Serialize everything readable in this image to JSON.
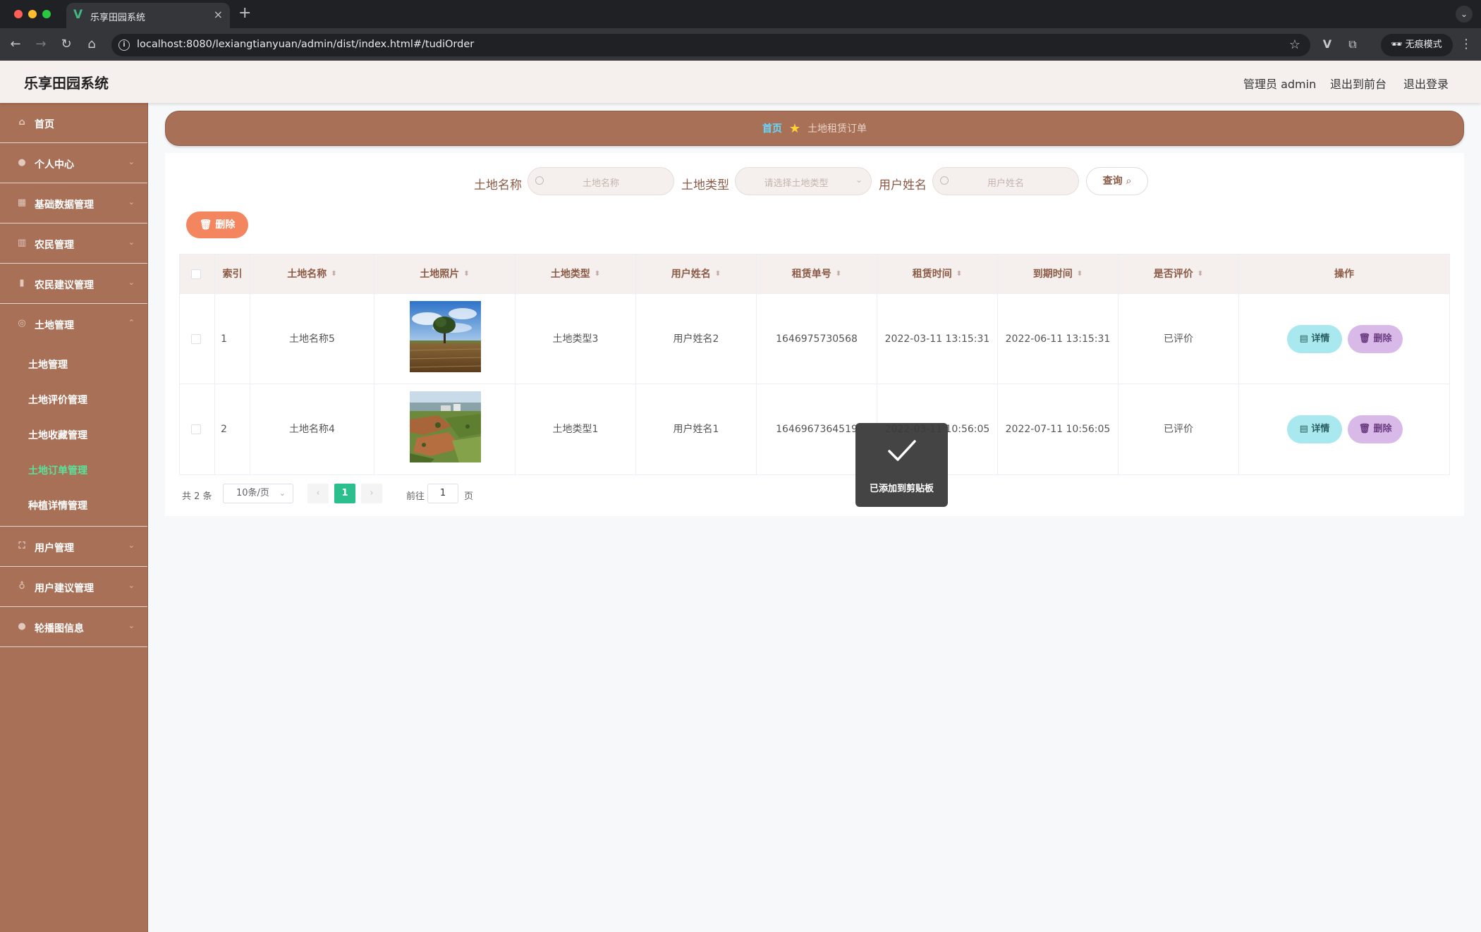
{
  "browser": {
    "tab_title": "乐享田园系统",
    "tab_close": "×",
    "new_tab": "+",
    "url": "localhost:8080/lexiangtianyuan/admin/dist/index.html#/tudiOrder",
    "incognito_label": "无痕模式"
  },
  "header": {
    "title": "乐享田园系统",
    "user_label": "管理员 admin",
    "front_link": "退出到前台",
    "logout_link": "退出登录"
  },
  "sidebar": {
    "items": [
      {
        "label": "首页",
        "icon": "home-icon"
      },
      {
        "label": "个人中心",
        "icon": "user-icon"
      },
      {
        "label": "基础数据管理",
        "icon": "grid-icon"
      },
      {
        "label": "农民管理",
        "icon": "building-icon"
      },
      {
        "label": "农民建议管理",
        "icon": "bar-chart-icon"
      },
      {
        "label": "土地管理",
        "icon": "compass-icon"
      }
    ],
    "sub_items": [
      {
        "label": "土地管理"
      },
      {
        "label": "土地评价管理"
      },
      {
        "label": "土地收藏管理"
      },
      {
        "label": "土地订单管理",
        "active": true
      },
      {
        "label": "种植详情管理"
      }
    ],
    "items_after": [
      {
        "label": "用户管理",
        "icon": "frame-icon"
      },
      {
        "label": "用户建议管理",
        "icon": "bulb-icon"
      },
      {
        "label": "轮播图信息",
        "icon": "person-icon"
      }
    ]
  },
  "breadcrumb": {
    "home": "首页",
    "current": "土地租赁订单"
  },
  "search": {
    "land_name_label": "土地名称",
    "land_name_placeholder": "土地名称",
    "land_type_label": "土地类型",
    "land_type_placeholder": "请选择土地类型",
    "user_name_label": "用户姓名",
    "user_name_placeholder": "用户姓名",
    "query_label": "查询"
  },
  "actions": {
    "delete_label": "删除"
  },
  "table": {
    "columns": [
      "索引",
      "土地名称",
      "土地照片",
      "土地类型",
      "用户姓名",
      "租赁单号",
      "租赁时间",
      "到期时间",
      "是否评价",
      "操作"
    ],
    "rows": [
      {
        "index": "1",
        "land_name": "土地名称5",
        "land_type": "土地类型3",
        "user_name": "用户姓名2",
        "order_no": "1646975730568",
        "rent_time": "2022-03-11 13:15:31",
        "expire_time": "2022-06-11 13:15:31",
        "evaluated": "已评价",
        "detail_label": "详情",
        "delete_label": "删除"
      },
      {
        "index": "2",
        "land_name": "土地名称4",
        "land_type": "土地类型1",
        "user_name": "用户姓名1",
        "order_no": "1646967364519",
        "rent_time": "2022-03-11 10:56:05",
        "expire_time": "2022-07-11 10:56:05",
        "evaluated": "已评价",
        "detail_label": "详情",
        "delete_label": "删除"
      }
    ]
  },
  "pagination": {
    "total_text": "共 2 条",
    "page_size": "10条/页",
    "current_page": "1",
    "goto_label": "前往",
    "goto_value": "1",
    "page_unit": "页"
  },
  "toast": {
    "message": "已添加到剪贴板"
  }
}
